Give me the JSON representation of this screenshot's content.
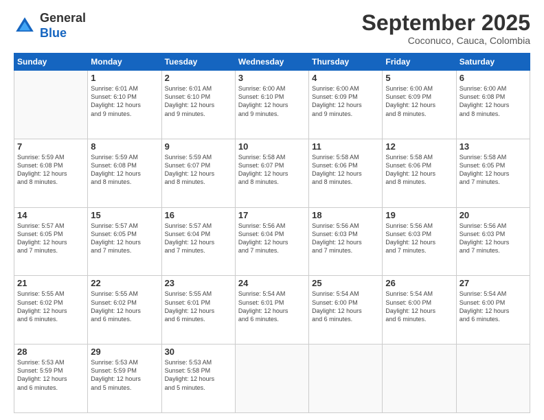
{
  "logo": {
    "line1": "General",
    "line2": "Blue"
  },
  "title": "September 2025",
  "location": "Coconuco, Cauca, Colombia",
  "days_of_week": [
    "Sunday",
    "Monday",
    "Tuesday",
    "Wednesday",
    "Thursday",
    "Friday",
    "Saturday"
  ],
  "weeks": [
    [
      {
        "day": "",
        "info": ""
      },
      {
        "day": "1",
        "info": "Sunrise: 6:01 AM\nSunset: 6:10 PM\nDaylight: 12 hours\nand 9 minutes."
      },
      {
        "day": "2",
        "info": "Sunrise: 6:01 AM\nSunset: 6:10 PM\nDaylight: 12 hours\nand 9 minutes."
      },
      {
        "day": "3",
        "info": "Sunrise: 6:00 AM\nSunset: 6:10 PM\nDaylight: 12 hours\nand 9 minutes."
      },
      {
        "day": "4",
        "info": "Sunrise: 6:00 AM\nSunset: 6:09 PM\nDaylight: 12 hours\nand 9 minutes."
      },
      {
        "day": "5",
        "info": "Sunrise: 6:00 AM\nSunset: 6:09 PM\nDaylight: 12 hours\nand 8 minutes."
      },
      {
        "day": "6",
        "info": "Sunrise: 6:00 AM\nSunset: 6:08 PM\nDaylight: 12 hours\nand 8 minutes."
      }
    ],
    [
      {
        "day": "7",
        "info": "Sunrise: 5:59 AM\nSunset: 6:08 PM\nDaylight: 12 hours\nand 8 minutes."
      },
      {
        "day": "8",
        "info": "Sunrise: 5:59 AM\nSunset: 6:08 PM\nDaylight: 12 hours\nand 8 minutes."
      },
      {
        "day": "9",
        "info": "Sunrise: 5:59 AM\nSunset: 6:07 PM\nDaylight: 12 hours\nand 8 minutes."
      },
      {
        "day": "10",
        "info": "Sunrise: 5:58 AM\nSunset: 6:07 PM\nDaylight: 12 hours\nand 8 minutes."
      },
      {
        "day": "11",
        "info": "Sunrise: 5:58 AM\nSunset: 6:06 PM\nDaylight: 12 hours\nand 8 minutes."
      },
      {
        "day": "12",
        "info": "Sunrise: 5:58 AM\nSunset: 6:06 PM\nDaylight: 12 hours\nand 8 minutes."
      },
      {
        "day": "13",
        "info": "Sunrise: 5:58 AM\nSunset: 6:05 PM\nDaylight: 12 hours\nand 7 minutes."
      }
    ],
    [
      {
        "day": "14",
        "info": "Sunrise: 5:57 AM\nSunset: 6:05 PM\nDaylight: 12 hours\nand 7 minutes."
      },
      {
        "day": "15",
        "info": "Sunrise: 5:57 AM\nSunset: 6:05 PM\nDaylight: 12 hours\nand 7 minutes."
      },
      {
        "day": "16",
        "info": "Sunrise: 5:57 AM\nSunset: 6:04 PM\nDaylight: 12 hours\nand 7 minutes."
      },
      {
        "day": "17",
        "info": "Sunrise: 5:56 AM\nSunset: 6:04 PM\nDaylight: 12 hours\nand 7 minutes."
      },
      {
        "day": "18",
        "info": "Sunrise: 5:56 AM\nSunset: 6:03 PM\nDaylight: 12 hours\nand 7 minutes."
      },
      {
        "day": "19",
        "info": "Sunrise: 5:56 AM\nSunset: 6:03 PM\nDaylight: 12 hours\nand 7 minutes."
      },
      {
        "day": "20",
        "info": "Sunrise: 5:56 AM\nSunset: 6:03 PM\nDaylight: 12 hours\nand 7 minutes."
      }
    ],
    [
      {
        "day": "21",
        "info": "Sunrise: 5:55 AM\nSunset: 6:02 PM\nDaylight: 12 hours\nand 6 minutes."
      },
      {
        "day": "22",
        "info": "Sunrise: 5:55 AM\nSunset: 6:02 PM\nDaylight: 12 hours\nand 6 minutes."
      },
      {
        "day": "23",
        "info": "Sunrise: 5:55 AM\nSunset: 6:01 PM\nDaylight: 12 hours\nand 6 minutes."
      },
      {
        "day": "24",
        "info": "Sunrise: 5:54 AM\nSunset: 6:01 PM\nDaylight: 12 hours\nand 6 minutes."
      },
      {
        "day": "25",
        "info": "Sunrise: 5:54 AM\nSunset: 6:00 PM\nDaylight: 12 hours\nand 6 minutes."
      },
      {
        "day": "26",
        "info": "Sunrise: 5:54 AM\nSunset: 6:00 PM\nDaylight: 12 hours\nand 6 minutes."
      },
      {
        "day": "27",
        "info": "Sunrise: 5:54 AM\nSunset: 6:00 PM\nDaylight: 12 hours\nand 6 minutes."
      }
    ],
    [
      {
        "day": "28",
        "info": "Sunrise: 5:53 AM\nSunset: 5:59 PM\nDaylight: 12 hours\nand 6 minutes."
      },
      {
        "day": "29",
        "info": "Sunrise: 5:53 AM\nSunset: 5:59 PM\nDaylight: 12 hours\nand 5 minutes."
      },
      {
        "day": "30",
        "info": "Sunrise: 5:53 AM\nSunset: 5:58 PM\nDaylight: 12 hours\nand 5 minutes."
      },
      {
        "day": "",
        "info": ""
      },
      {
        "day": "",
        "info": ""
      },
      {
        "day": "",
        "info": ""
      },
      {
        "day": "",
        "info": ""
      }
    ]
  ]
}
